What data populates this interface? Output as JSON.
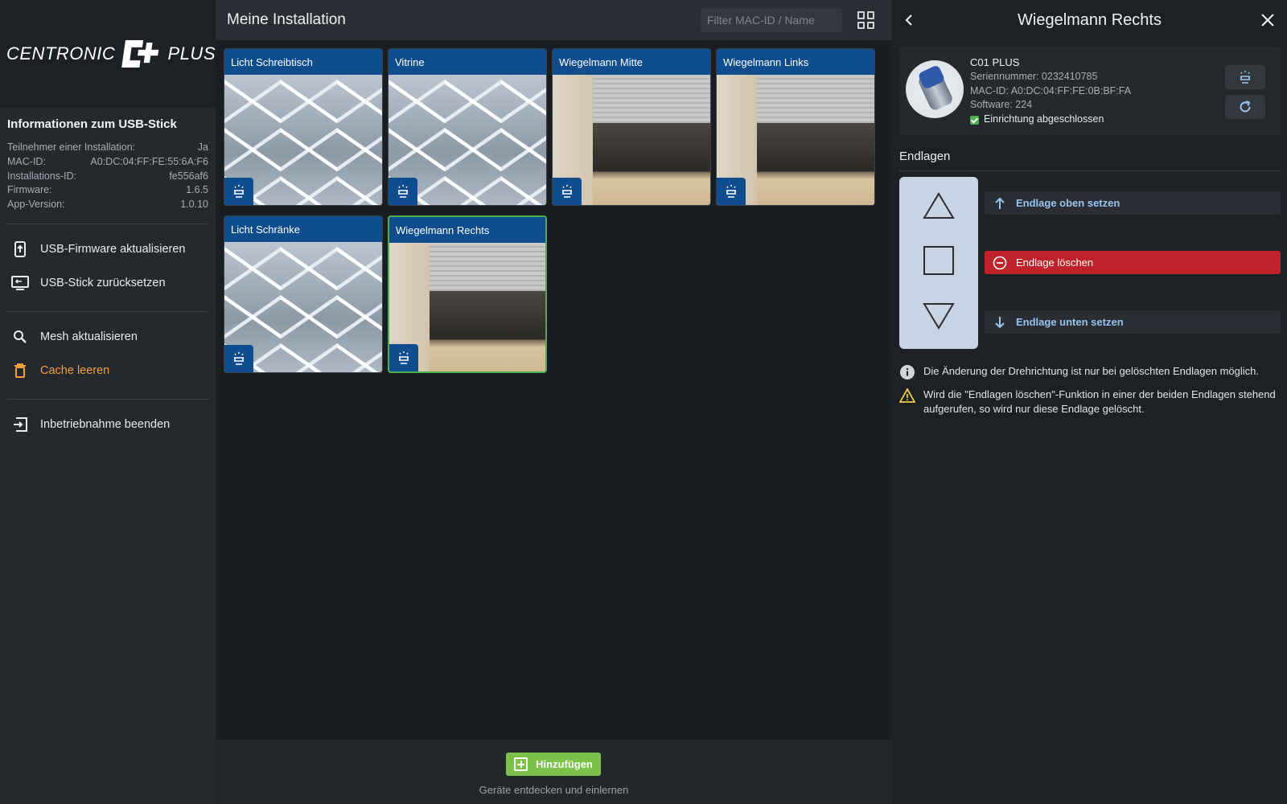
{
  "brand": {
    "left": "CENTRONIC",
    "right": "PLUS"
  },
  "sidebar": {
    "info_title": "Informationen zum USB-Stick",
    "info_rows": [
      {
        "label": "Teilnehmer einer Installation:",
        "value": "Ja"
      },
      {
        "label": "MAC-ID:",
        "value": "A0:DC:04:FF:FE:55:6A:F6"
      },
      {
        "label": "Installations-ID:",
        "value": "fe556af6"
      },
      {
        "label": "Firmware:",
        "value": "1.6.5"
      },
      {
        "label": "App-Version:",
        "value": "1.0.10"
      }
    ],
    "menu": [
      {
        "label": "USB-Firmware aktualisieren",
        "icon": "usb-upload-icon"
      },
      {
        "label": "USB-Stick zurücksetzen",
        "icon": "usb-reset-icon"
      },
      {
        "label": "Mesh aktualisieren",
        "icon": "search-icon"
      },
      {
        "label": "Cache leeren",
        "icon": "trash-icon",
        "color": "#f0a13a"
      },
      {
        "label": "Inbetriebnahme beenden",
        "icon": "exit-icon"
      }
    ]
  },
  "main": {
    "title": "Meine Installation",
    "filter_placeholder": "Filter MAC-ID / Name",
    "cards": [
      {
        "name": "Licht Schreibtisch",
        "image": "ceiling"
      },
      {
        "name": "Vitrine",
        "image": "ceiling"
      },
      {
        "name": "Wiegelmann Mitte",
        "image": "window"
      },
      {
        "name": "Wiegelmann Links",
        "image": "window"
      },
      {
        "name": "Licht Schränke",
        "image": "ceiling"
      },
      {
        "name": "Wiegelmann Rechts",
        "image": "window",
        "selected": true
      }
    ],
    "add_button": "Hinzufügen",
    "add_hint": "Geräte entdecken und einlernen"
  },
  "panel": {
    "title": "Wiegelmann Rechts",
    "device": {
      "model": "C01 PLUS",
      "serial": "Seriennummer: 0232410785",
      "mac": "MAC-ID: A0:DC:04:FF:FE:0B:BF:FA",
      "software": "Software: 224",
      "status": "Einrichtung abgeschlossen"
    },
    "section_title": "Endlagen",
    "actions": {
      "top": "Endlage oben setzen",
      "delete": "Endlage löschen",
      "bottom": "Endlage unten setzen"
    },
    "notes": {
      "info": "Die Änderung der Drehrichtung ist nur bei gelöschten Endlagen möglich.",
      "warning": "Wird die \"Endlagen löschen\"-Funktion in einer der beiden Endlagen stehend aufgerufen, so wird nur diese Endlage gelöscht."
    },
    "colors": {
      "accent": "#9ac4ee",
      "danger": "#c0222b",
      "card_header": "#0f4d8e",
      "success": "#4caf50"
    }
  }
}
